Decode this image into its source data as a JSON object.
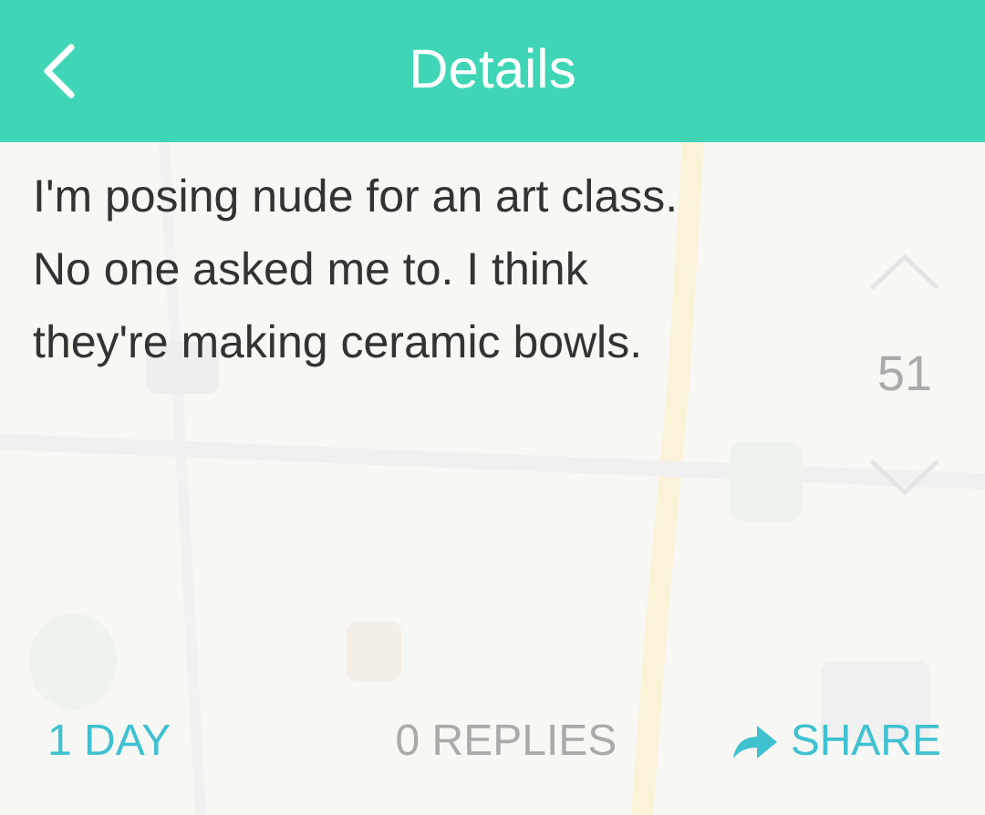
{
  "header": {
    "title": "Details"
  },
  "post": {
    "text": "I'm posing nude for an art class. No one asked me to. I think they're making ceramic bowls.",
    "score": "51"
  },
  "footer": {
    "age": "1 DAY",
    "replies": "0 REPLIES",
    "share": "SHARE"
  }
}
